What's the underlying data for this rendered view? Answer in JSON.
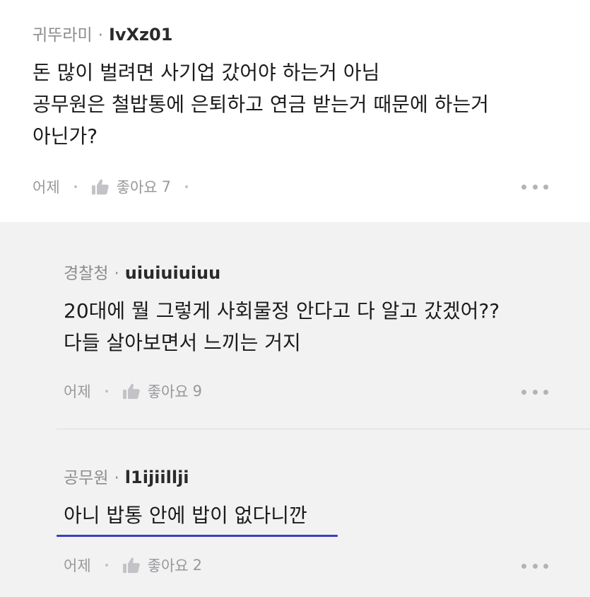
{
  "comment": {
    "nickname": "귀뚜라미",
    "separator": "·",
    "user_id": "IvXz01",
    "lines": [
      "돈 많이 벌려면 사기업 갔어야 하는거 아님",
      "공무원은 철밥통에 은퇴하고 연금 받는거 때문에 하는거",
      "아닌가?"
    ],
    "date": "어제",
    "like_label": "좋아요",
    "like_count": "7"
  },
  "replies": [
    {
      "nickname": "경찰청",
      "separator": "·",
      "user_id": "uiuiuiuiuu",
      "lines": [
        "20대에 뭘 그렇게 사회물정 안다고 다 알고 갔겠어??",
        "다들 살아보면서 느끼는 거지"
      ],
      "date": "어제",
      "like_label": "좋아요",
      "like_count": "9"
    },
    {
      "nickname": "공무원",
      "separator": "·",
      "user_id": "l1ijiillji",
      "lines": [
        "아니 밥통 안에 밥이 없다니깐"
      ],
      "date": "어제",
      "like_label": "좋아요",
      "like_count": "2"
    }
  ],
  "colors": {
    "reply_background": "#f2f2f3",
    "underline": "#3b3fbe",
    "muted_text": "#98989c"
  },
  "icons": {
    "like": "thumbs-up-icon",
    "more": "more-horizontal-icon"
  }
}
